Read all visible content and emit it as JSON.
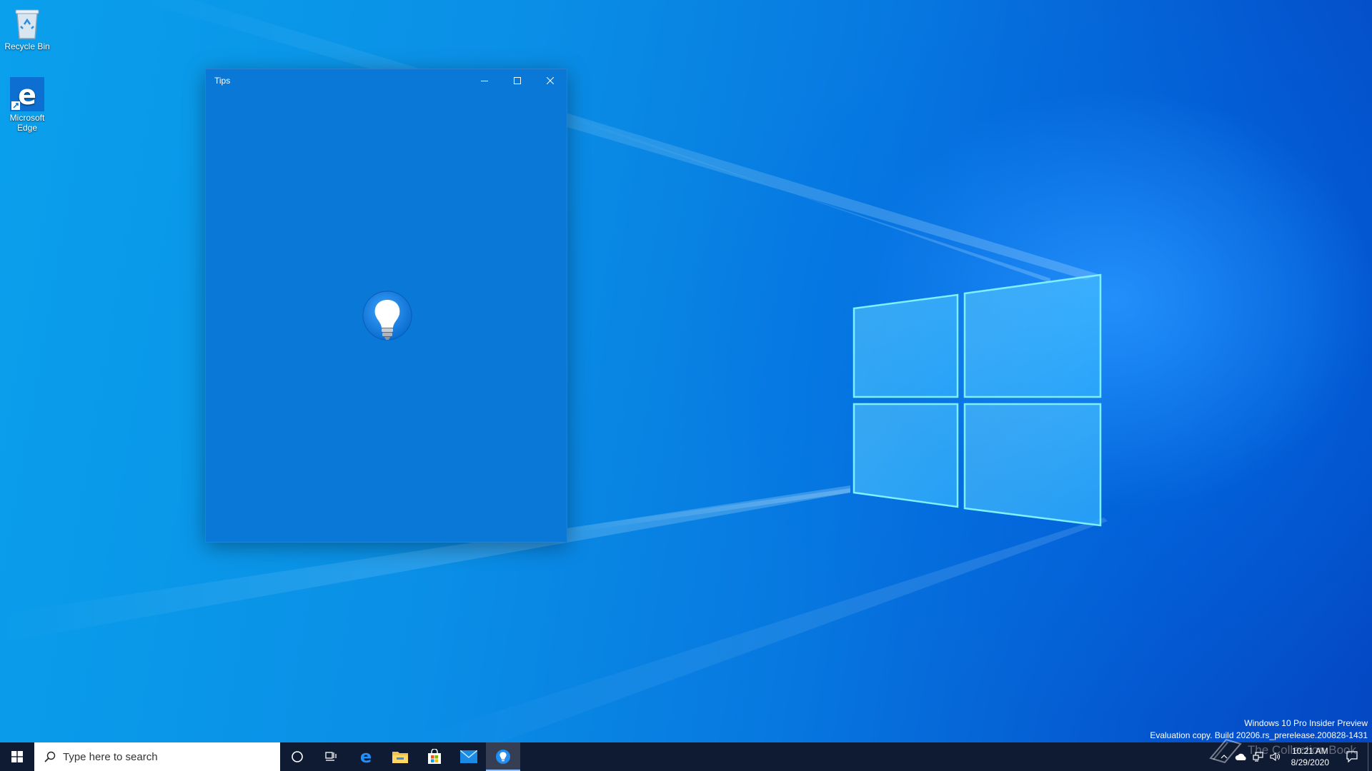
{
  "desktop": {
    "icons": [
      {
        "label": "Recycle Bin",
        "icon": "recycle-bin-icon"
      },
      {
        "label": "Microsoft Edge",
        "icon": "edge-icon"
      }
    ]
  },
  "window": {
    "title": "Tips",
    "controls": {
      "minimize": "minimize-icon",
      "maximize": "maximize-icon",
      "close": "close-icon"
    },
    "background": "#0a78d6",
    "splash_icon": "lightbulb-icon"
  },
  "watermark": {
    "line1": "Windows 10 Pro Insider Preview",
    "line2": "Evaluation copy. Build 20206.rs_prerelease.200828-1431"
  },
  "overlay_watermark": {
    "text": "The Collection Book"
  },
  "taskbar": {
    "search_placeholder": "Type here to search",
    "pinned": [
      {
        "name": "cortana",
        "icon": "cortana-circle-icon"
      },
      {
        "name": "task-view",
        "icon": "task-view-icon"
      },
      {
        "name": "edge",
        "icon": "edge-icon"
      },
      {
        "name": "file-explorer",
        "icon": "folder-icon"
      },
      {
        "name": "store",
        "icon": "store-icon"
      },
      {
        "name": "mail",
        "icon": "mail-icon"
      },
      {
        "name": "tips",
        "icon": "lightbulb-icon",
        "active": true
      }
    ],
    "tray": {
      "time": "10:21 AM",
      "date": "8/29/2020",
      "icons": [
        "chevron-up-icon",
        "onedrive-cloud-icon",
        "network-icon",
        "volume-icon"
      ]
    }
  },
  "colors": {
    "taskbar": "#0f1a33",
    "accent": "#0a78d6",
    "desktop": "#0a8fe6"
  }
}
